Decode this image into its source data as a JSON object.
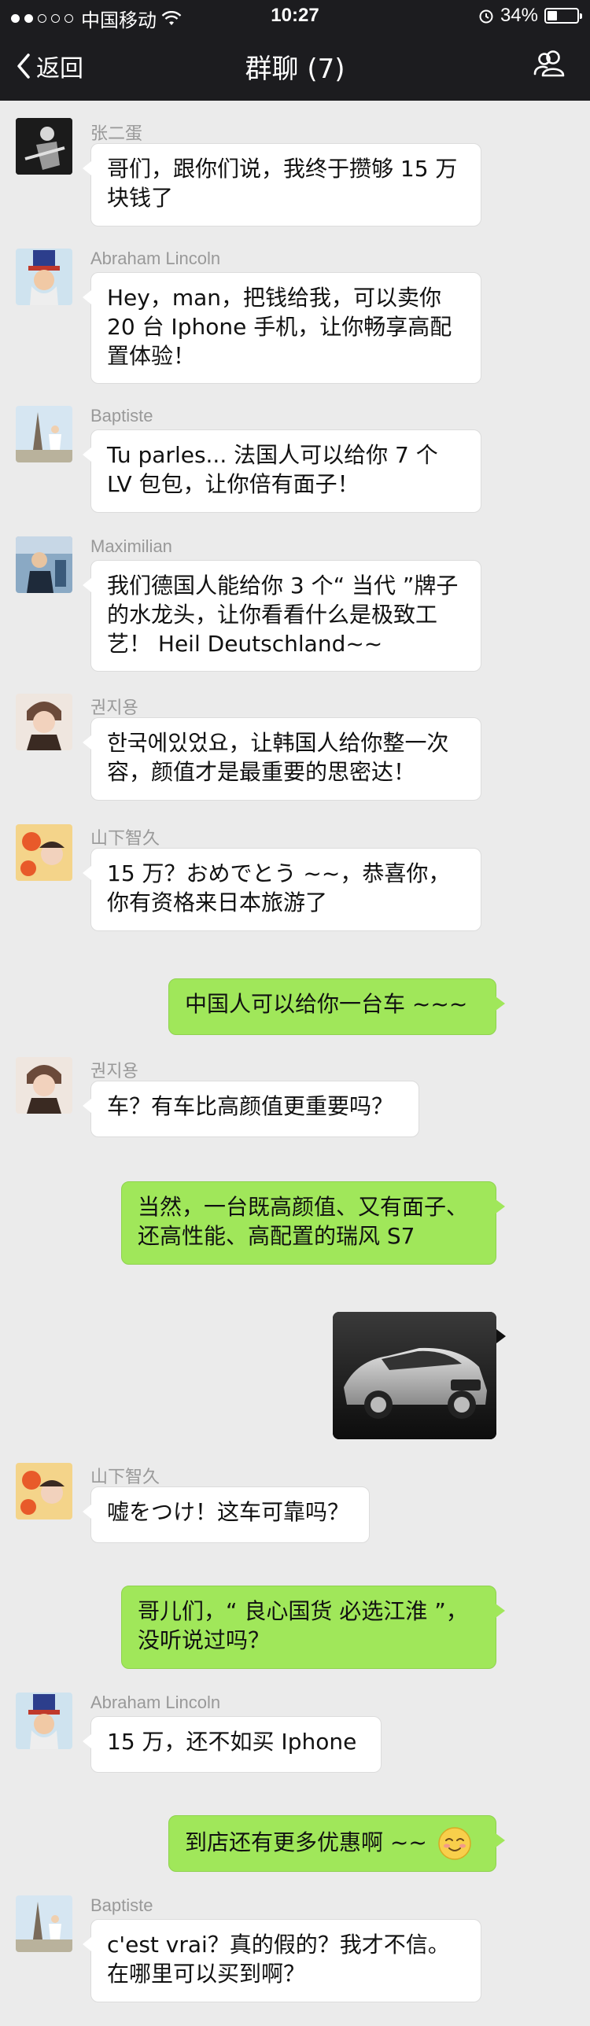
{
  "status_bar": {
    "carrier": "中国移动",
    "time": "10:27",
    "battery": "34%",
    "battery_level": 0.34
  },
  "nav": {
    "back_label": "返回",
    "title": "群聊 (7)"
  },
  "messages": [
    {
      "side": "left",
      "sender": "张二蛋",
      "text": "哥们，跟你们说，我终于攒够 15 万块钱了"
    },
    {
      "side": "left",
      "sender": "Abraham Lincoln",
      "text": "Hey，man，把钱给我，可以卖你 20 台 Iphone 手机，让你畅享高配置体验！"
    },
    {
      "side": "left",
      "sender": "Baptiste",
      "text": "Tu parles... 法国人可以给你 7 个 LV 包包，让你倍有面子！"
    },
    {
      "side": "left",
      "sender": "Maximilian",
      "text": "我们德国人能给你 3 个“ 当代 ”牌子的水龙头，让你看看什么是极致工艺！ Heil Deutschland~~"
    },
    {
      "side": "left",
      "sender": "권지용",
      "text": "한국에있었요，让韩国人给你整一次容，颜值才是最重要的思密达！"
    },
    {
      "side": "left",
      "sender": "山下智久",
      "text": "15 万？おめでとう ~~，恭喜你，你有资格来日本旅游了"
    },
    {
      "side": "right",
      "text": "中国人可以给你一台车 ~~~"
    },
    {
      "side": "left",
      "sender": "권지용",
      "text": "车？有车比高颜值更重要吗？"
    },
    {
      "side": "right",
      "text": "当然，一台既高颜值、又有面子、还高性能、高配置的瑞风 S7"
    },
    {
      "side": "right",
      "image": "car-photo"
    },
    {
      "side": "left",
      "sender": "山下智久",
      "text": "嘘をつけ！这车可靠吗？"
    },
    {
      "side": "right",
      "text": "哥儿们，“ 良心国货 必选江淮 ”，没听说过吗？"
    },
    {
      "side": "left",
      "sender": "Abraham Lincoln",
      "text": "15 万，还不如买 Iphone"
    },
    {
      "side": "right",
      "text": "到店还有更多优惠啊 ~~",
      "emoji": "smiling-face-emoji"
    },
    {
      "side": "left",
      "sender": "Baptiste",
      "text": "c'est vrai？真的假的？我才不信。在哪里可以买到啊？"
    }
  ],
  "colors": {
    "background": "#ebebeb",
    "navbar": "#1c1c1f",
    "bubble_right": "#a0e75a",
    "bubble_left": "#ffffff"
  }
}
